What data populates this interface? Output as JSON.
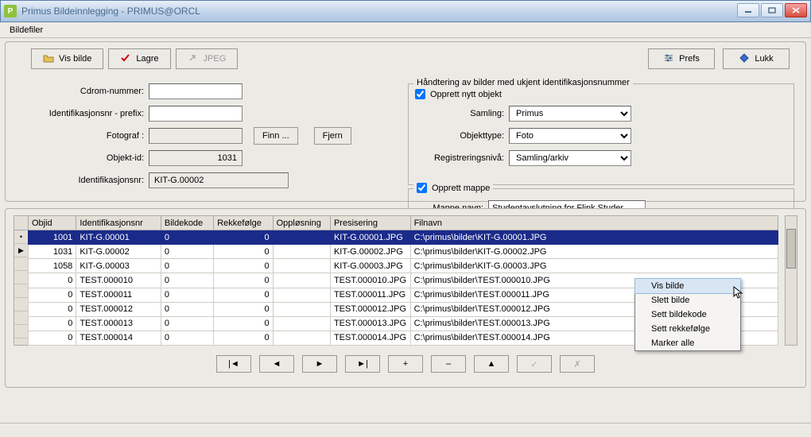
{
  "window": {
    "title": "Primus Bildeinnlegging - PRIMUS@ORCL",
    "app_icon_glyph": "P"
  },
  "menubar": {
    "items": [
      "Bildefiler"
    ]
  },
  "toolbar": {
    "vis_bilde": "Vis bilde",
    "lagre": "Lagre",
    "jpeg": "JPEG",
    "prefs": "Prefs",
    "lukk": "Lukk"
  },
  "form_left": {
    "cdrom_label": "Cdrom-nummer:",
    "cdrom_value": "",
    "prefix_label": "Identifikasjonsnr - prefix:",
    "prefix_value": "",
    "fotograf_label": "Fotograf :",
    "fotograf_value": "",
    "finn_btn": "Finn ...",
    "fjern_btn": "Fjern",
    "objektid_label": "Objekt-id:",
    "objektid_value": "1031",
    "idnr_label": "Identifikasjonsnr:",
    "idnr_value": "KIT-G.00002"
  },
  "group_right": {
    "title": "Håndtering av bilder med ukjent identifikasjonsnummer",
    "opprett_objekt_label": "Opprett nytt objekt",
    "opprett_objekt_checked": true,
    "samling_label": "Samling:",
    "samling_value": "Primus",
    "objekttype_label": "Objekttype:",
    "objekttype_value": "Foto",
    "regniva_label": "Registreringsnivå:",
    "regniva_value": "Samling/arkiv",
    "opprett_mappe_label": "Opprett mappe",
    "opprett_mappe_checked": true,
    "mappe_navn_label": "Mappe navn:",
    "mappe_navn_value": "Studentavslutning for Flink Studer"
  },
  "grid": {
    "columns": [
      "Objid",
      "Identifikasjonsnr",
      "Bildekode",
      "Rekkefølge",
      "Oppløsning",
      "Presisering",
      "Filnavn"
    ],
    "rows": [
      {
        "objid": "1001",
        "id": "KIT-G.00001",
        "bk": "0",
        "rk": "0",
        "op": "",
        "pr": "KIT-G.00001.JPG",
        "fn": "C:\\primus\\bilder\\KIT-G.00001.JPG",
        "sel": true
      },
      {
        "objid": "1031",
        "id": "KIT-G.00002",
        "bk": "0",
        "rk": "0",
        "op": "",
        "pr": "KIT-G.00002.JPG",
        "fn": "C:\\primus\\bilder\\KIT-G.00002.JPG",
        "cur": true
      },
      {
        "objid": "1058",
        "id": "KIT-G.00003",
        "bk": "0",
        "rk": "0",
        "op": "",
        "pr": "KIT-G.00003.JPG",
        "fn": "C:\\primus\\bilder\\KIT-G.00003.JPG",
        "dotted": true
      },
      {
        "objid": "0",
        "id": "TEST.000010",
        "bk": "0",
        "rk": "0",
        "op": "",
        "pr": "TEST.000010.JPG",
        "fn": "C:\\primus\\bilder\\TEST.000010.JPG"
      },
      {
        "objid": "0",
        "id": "TEST.000011",
        "bk": "0",
        "rk": "0",
        "op": "",
        "pr": "TEST.000011.JPG",
        "fn": "C:\\primus\\bilder\\TEST.000011.JPG"
      },
      {
        "objid": "0",
        "id": "TEST.000012",
        "bk": "0",
        "rk": "0",
        "op": "",
        "pr": "TEST.000012.JPG",
        "fn": "C:\\primus\\bilder\\TEST.000012.JPG"
      },
      {
        "objid": "0",
        "id": "TEST.000013",
        "bk": "0",
        "rk": "0",
        "op": "",
        "pr": "TEST.000013.JPG",
        "fn": "C:\\primus\\bilder\\TEST.000013.JPG"
      },
      {
        "objid": "0",
        "id": "TEST.000014",
        "bk": "0",
        "rk": "0",
        "op": "",
        "pr": "TEST.000014.JPG",
        "fn": "C:\\primus\\bilder\\TEST.000014.JPG"
      }
    ]
  },
  "nav": {
    "first": "|◄",
    "prev": "◄",
    "next": "►",
    "last": "►|",
    "plus": "+",
    "minus": "–",
    "up": "▲",
    "check": "✓",
    "x": "✗"
  },
  "context_menu": {
    "items": [
      "Vis bilde",
      "Slett bilde",
      "Sett bildekode",
      "Sett rekkefølge",
      "Marker alle"
    ],
    "highlighted": 0
  }
}
